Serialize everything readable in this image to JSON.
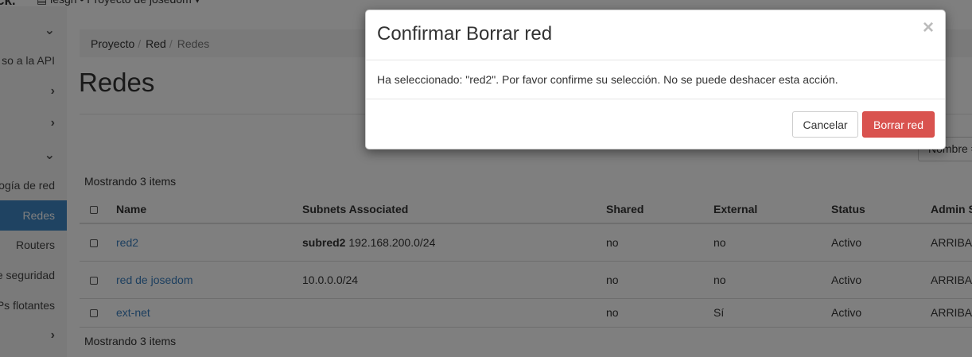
{
  "header": {
    "brand": "ck.",
    "project_picker": "▤ lesgh • Proyecto de josedom ▾"
  },
  "sidebar": {
    "items": [
      {
        "label": "",
        "icon": "chevron-down-icon"
      },
      {
        "label": "so a la API"
      },
      {
        "label": "",
        "icon": "chevron-right-icon"
      },
      {
        "label": "",
        "icon": "chevron-right-icon"
      },
      {
        "label": "",
        "icon": "chevron-down-icon"
      },
      {
        "label": "ogía de red"
      },
      {
        "label": "Redes",
        "active": true
      },
      {
        "label": "Routers"
      },
      {
        "label": "e seguridad"
      },
      {
        "label": "Ps flotantes"
      },
      {
        "label": "",
        "icon": "chevron-right-icon"
      }
    ]
  },
  "breadcrumb": {
    "items": [
      "Proyecto",
      "Red",
      "Redes"
    ]
  },
  "page": {
    "title": "Redes",
    "filter_label": "Nombre ="
  },
  "table": {
    "count_top": "Mostrando 3 items",
    "count_bottom": "Mostrando 3 items",
    "headers": [
      "Name",
      "Subnets Associated",
      "Shared",
      "External",
      "Status",
      "Admin S"
    ],
    "rows": [
      {
        "name": "red2",
        "subnet_name": "subred2",
        "subnet_cidr": "192.168.200.0/24",
        "shared": "no",
        "external": "no",
        "status": "Activo",
        "admin": "ARRIBA"
      },
      {
        "name": "red de josedom",
        "subnet_name": "",
        "subnet_cidr": "10.0.0.0/24",
        "shared": "no",
        "external": "no",
        "status": "Activo",
        "admin": "ARRIBA"
      },
      {
        "name": "ext-net",
        "subnet_name": "",
        "subnet_cidr": "",
        "shared": "no",
        "external": "Sí",
        "status": "Activo",
        "admin": "ARRIBA"
      }
    ]
  },
  "modal": {
    "title": "Confirmar Borrar red",
    "close": "×",
    "body": "Ha seleccionado: \"red2\". Por favor confirme su selección. No se puede deshacer esta acción.",
    "cancel_label": "Cancelar",
    "confirm_label": "Borrar red"
  },
  "colors": {
    "accent": "#3f87c4",
    "danger": "#d9534f",
    "link": "#3b7fbf"
  }
}
